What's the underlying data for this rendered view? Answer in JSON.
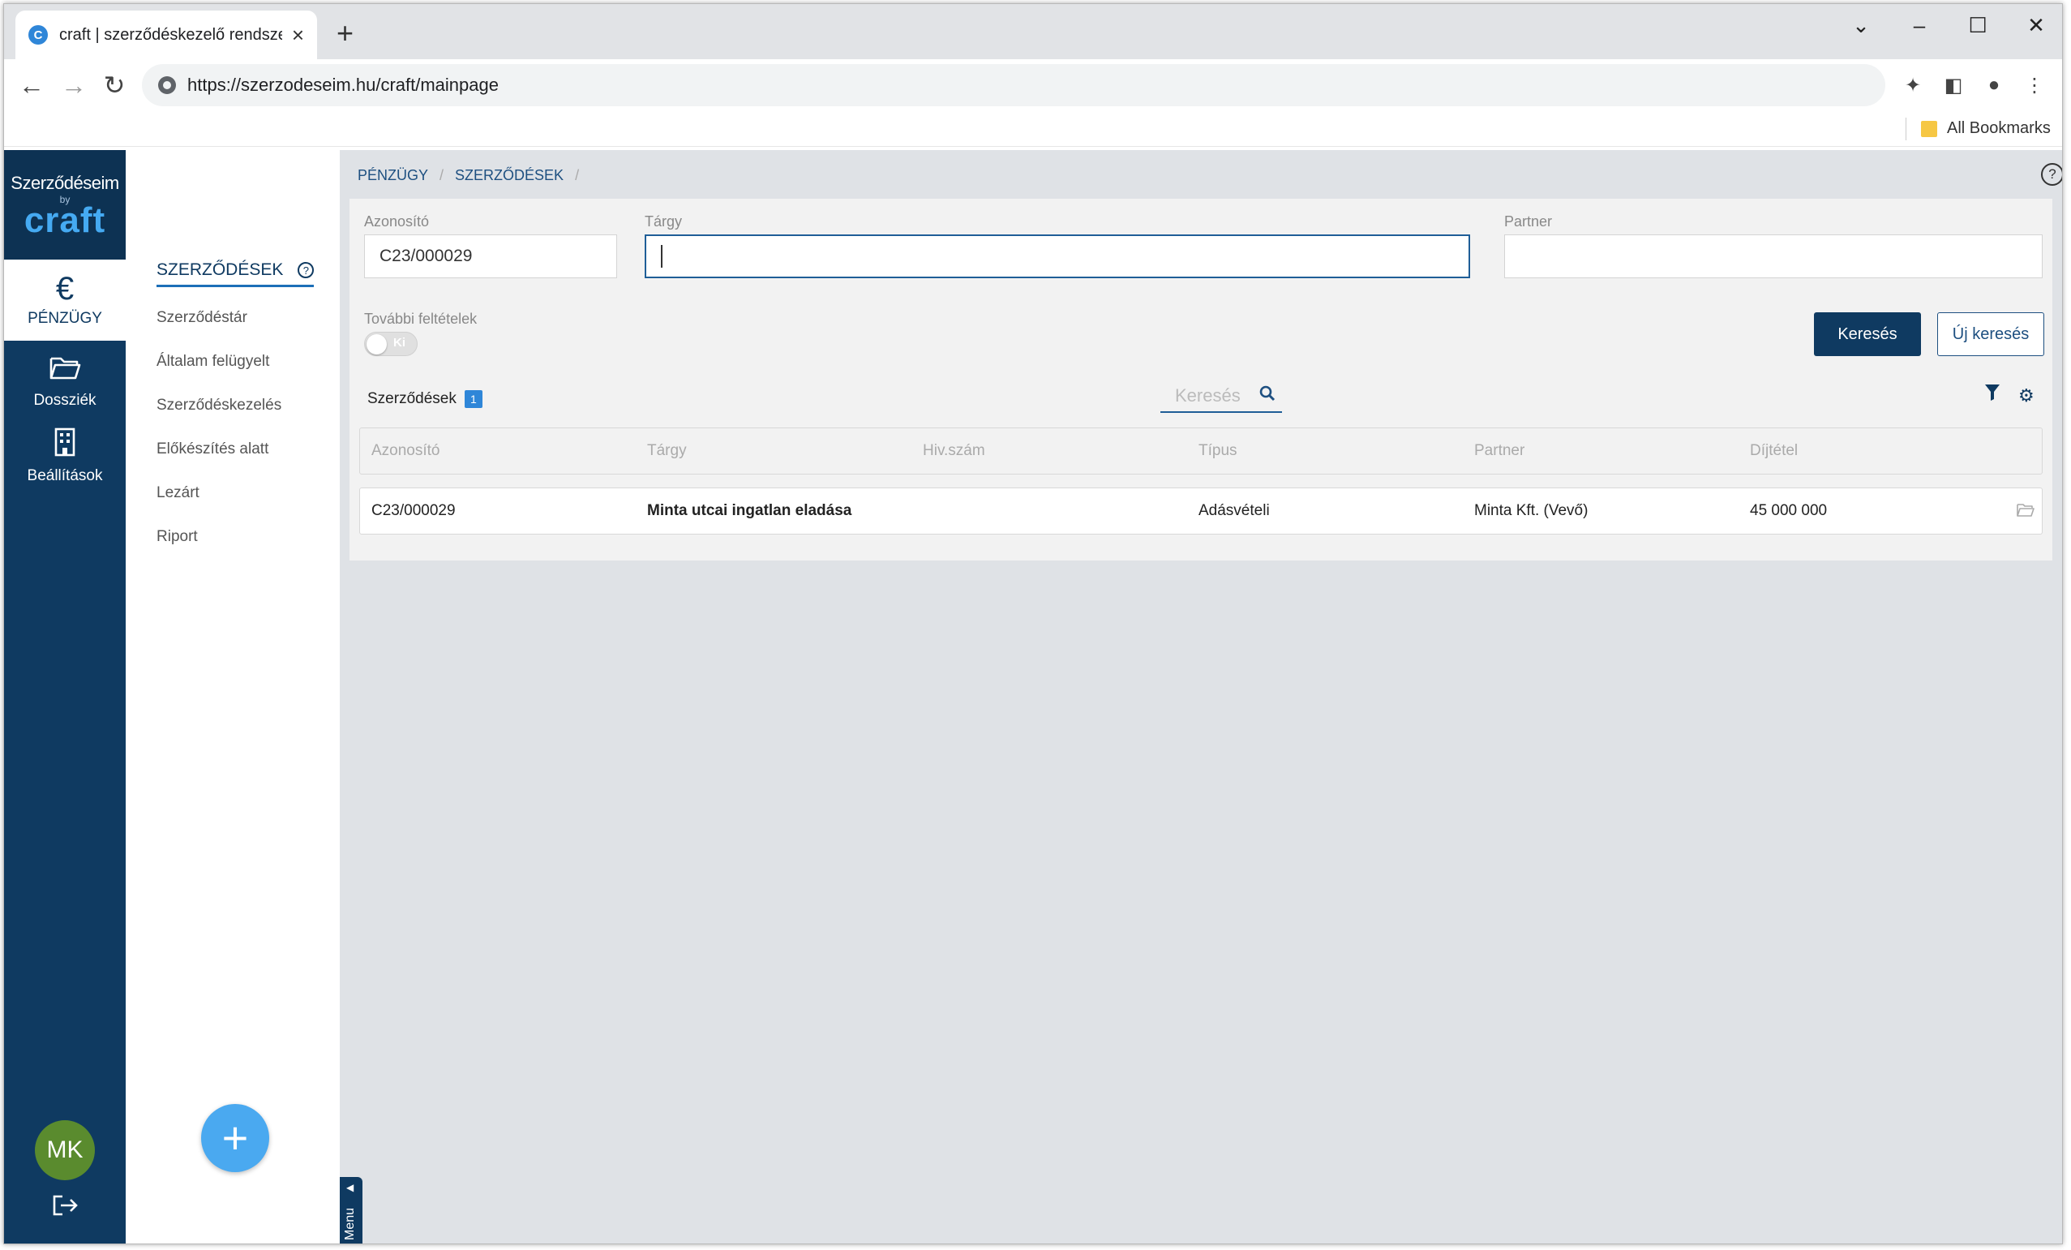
{
  "browser": {
    "tab_title": "craft | szerződéskezelő rendszer",
    "favicon_letter": "C",
    "url": "https://szerzodeseim.hu/craft/mainpage",
    "bookmarks_label": "All Bookmarks"
  },
  "logo": {
    "top": "Szerződéseim",
    "by": "by",
    "brand": "craft"
  },
  "leftbar": {
    "items": [
      {
        "label": "PÉNZÜGY",
        "icon": "euro-icon"
      },
      {
        "label": "Dossziék",
        "icon": "folder-icon"
      },
      {
        "label": "Beállítások",
        "icon": "building-icon"
      }
    ],
    "avatar_initials": "MK"
  },
  "submenu": {
    "heading": "SZERZŐDÉSEK",
    "items": [
      "Szerződéstár",
      "Általam felügyelt",
      "Szerződéskezelés",
      "Előkészítés alatt",
      "Lezárt",
      "Riport"
    ],
    "add_button": "+",
    "menu_tab": "Menu"
  },
  "breadcrumb": [
    "PÉNZÜGY",
    "SZERZŐDÉSEK"
  ],
  "filters": {
    "azonosito_label": "Azonosító",
    "azonosito_value": "C23/000029",
    "targy_label": "Tárgy",
    "targy_value": "",
    "partner_label": "Partner",
    "partner_value": "",
    "more_label": "További feltételek",
    "toggle_text": "Ki",
    "search_button": "Keresés",
    "new_search_button": "Új keresés"
  },
  "list": {
    "title": "Szerződések",
    "count": "1",
    "search_placeholder": "Keresés",
    "columns": [
      "Azonosító",
      "Tárgy",
      "Hiv.szám",
      "Típus",
      "Partner",
      "Díjtétel"
    ],
    "rows": [
      {
        "azonosito": "C23/000029",
        "targy": "Minta utcai ingatlan eladása",
        "hivszam": "",
        "tipus": "Adásvételi",
        "partner": "Minta Kft. (Vevő)",
        "dijtetel": "45 000 000"
      }
    ]
  },
  "colors": {
    "navy": "#0f3a61",
    "accent_blue": "#4aa9f0",
    "avatar_green": "#5a8b2e"
  }
}
